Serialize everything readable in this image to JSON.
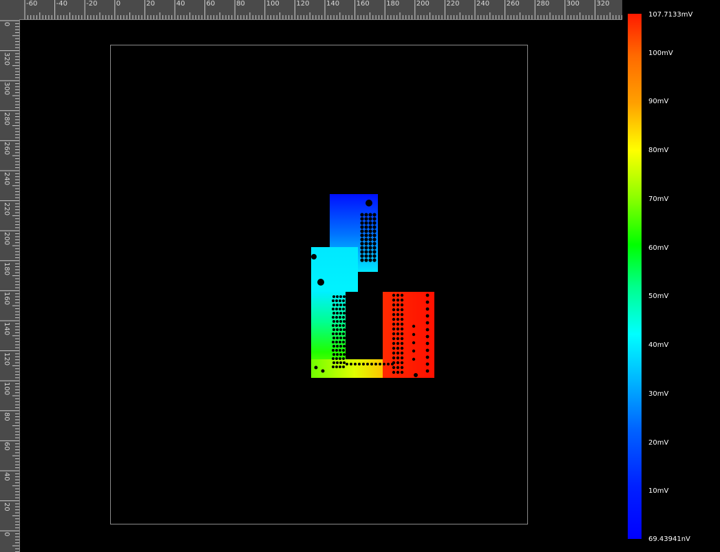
{
  "rulers": {
    "top_ticks": [
      "-60",
      "-40",
      "-20",
      "0",
      "20",
      "40",
      "60",
      "80",
      "100",
      "120",
      "140",
      "160",
      "180",
      "200",
      "220",
      "240",
      "260",
      "280",
      "300",
      "320"
    ],
    "left_ticks": [
      "0",
      "320",
      "300",
      "280",
      "260",
      "240",
      "220",
      "200",
      "180",
      "160",
      "140",
      "120",
      "100",
      "80",
      "60",
      "40",
      "20",
      "0"
    ]
  },
  "colorbar": {
    "max_label": "107.7133mV",
    "min_label": "69.43941nV",
    "tick_labels": [
      "100mV",
      "90mV",
      "80mV",
      "70mV",
      "60mV",
      "50mV",
      "40mV",
      "30mV",
      "20mV",
      "10mV"
    ]
  },
  "colors": {
    "background": "#000000",
    "ruler": "#4a4a4a",
    "outline": "#8c8c8c"
  }
}
